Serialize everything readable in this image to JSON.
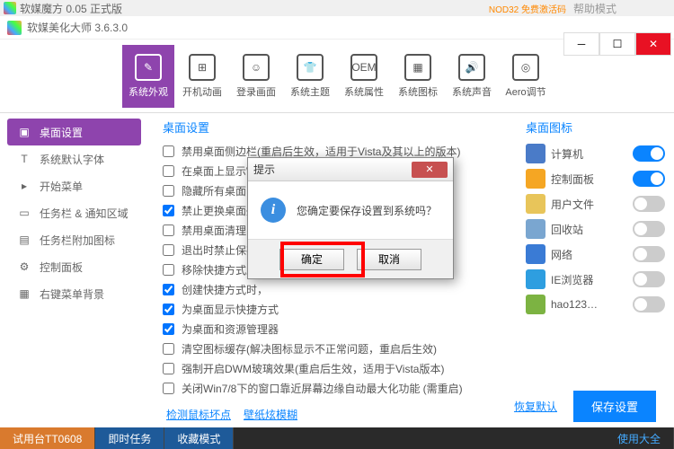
{
  "titlebar": {
    "app": "软媒魔方 0.05 正式版",
    "nod": "NOD32 免费激活码",
    "label2": "帮助模式"
  },
  "window_title": "软媒美化大师 3.6.3.0",
  "toolbar": [
    {
      "label": "系统外观",
      "icon": "brush"
    },
    {
      "label": "开机动画",
      "icon": "windows"
    },
    {
      "label": "登录画面",
      "icon": "user"
    },
    {
      "label": "系统主题",
      "icon": "shirt"
    },
    {
      "label": "系统属性",
      "icon": "oem"
    },
    {
      "label": "系统图标",
      "icon": "picture"
    },
    {
      "label": "系统声音",
      "icon": "sound"
    },
    {
      "label": "Aero调节",
      "icon": "target"
    }
  ],
  "sidebar": [
    {
      "label": "桌面设置"
    },
    {
      "label": "系统默认字体"
    },
    {
      "label": "开始菜单"
    },
    {
      "label": "任务栏 & 通知区域"
    },
    {
      "label": "任务栏附加图标"
    },
    {
      "label": "控制面板"
    },
    {
      "label": "右键菜单背景"
    }
  ],
  "section_title": "桌面设置",
  "checks": [
    {
      "label": "禁用桌面侧边栏(重启后生效，适用于Vista及其以上的版本)",
      "c": false
    },
    {
      "label": "在桌面上显示Windows版本信息(需重启)",
      "c": false
    },
    {
      "label": "隐藏所有桌面内容",
      "c": false
    },
    {
      "label": "禁止更换桌面壁纸",
      "c": true
    },
    {
      "label": "禁用桌面清理向导",
      "c": false
    },
    {
      "label": "退出时禁止保存设置",
      "c": false
    },
    {
      "label": "移除快捷方式上的",
      "c": false
    },
    {
      "label": "创建快捷方式时，",
      "c": true
    },
    {
      "label": "为桌面显示快捷方式",
      "c": true
    },
    {
      "label": "为桌面和资源管理器",
      "c": true
    },
    {
      "label": "清空图标缓存(解决图标显示不正常问题，重启后生效)",
      "c": false
    },
    {
      "label": "强制开启DWM玻璃效果(重启后生效，适用于Vista版本)",
      "c": false
    },
    {
      "label": "关闭Win7/8下的窗口靠近屏幕边缘自动最大化功能 (需重启)",
      "c": false
    }
  ],
  "right_title": "桌面图标",
  "icons": [
    {
      "label": "计算机",
      "on": true,
      "bg": "#4a7bc8"
    },
    {
      "label": "控制面板",
      "on": true,
      "bg": "#f5a623"
    },
    {
      "label": "用户文件",
      "on": false,
      "bg": "#e8c55a"
    },
    {
      "label": "回收站",
      "on": false,
      "bg": "#7aa6d0"
    },
    {
      "label": "网络",
      "on": false,
      "bg": "#3a7bd5"
    },
    {
      "label": "IE浏览器",
      "on": false,
      "bg": "#2e9ee0"
    },
    {
      "label": "hao123…",
      "on": false,
      "bg": "#7cb342"
    }
  ],
  "footer": {
    "restore": "恢复默认",
    "save": "保存设置",
    "link1": "检测鼠标坏点",
    "link2": "壁纸炫模糊"
  },
  "dialog": {
    "title": "提示",
    "msg": "您确定要保存设置到系统吗？",
    "ok": "确定",
    "cancel": "取消"
  },
  "taskbar": {
    "a": "试用台TT0608",
    "b": "即时任务",
    "c": "收藏模式",
    "d": "使用大全"
  }
}
